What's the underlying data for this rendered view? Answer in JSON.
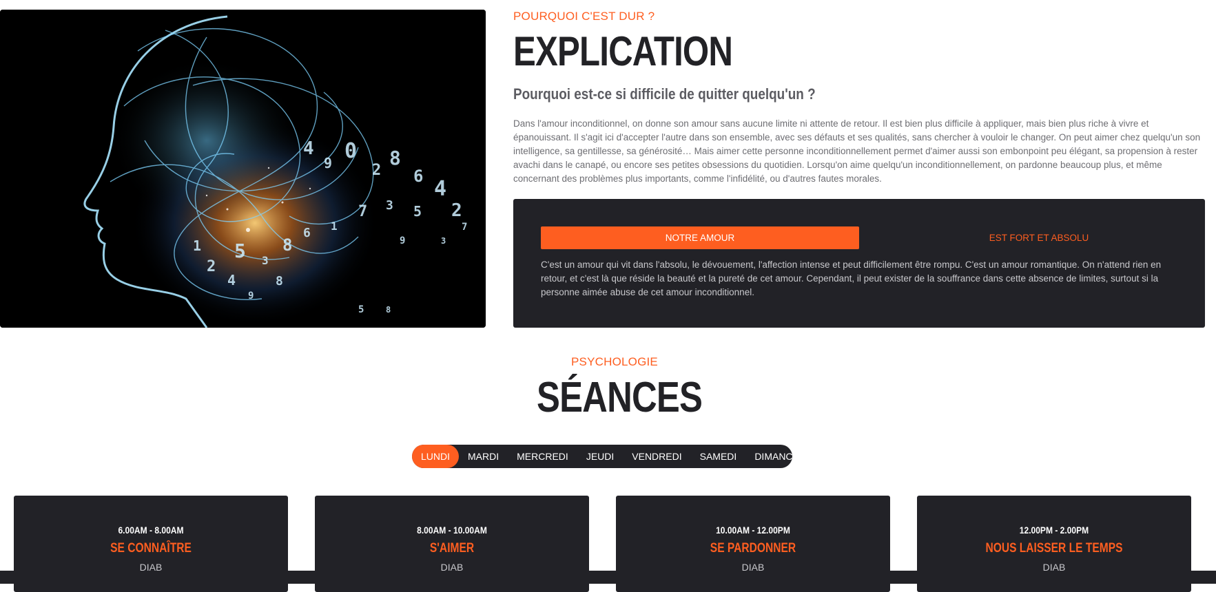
{
  "explication": {
    "kicker": "POURQUOI C'EST DUR ?",
    "title": "EXPLICATION",
    "subtitle": "Pourquoi est-ce si difficile de quitter quelqu'un ?",
    "paragraph": "Dans l'amour inconditionnel, on donne son amour sans aucune limite ni attente de retour. Il est bien plus difficile à appliquer, mais bien plus riche à vivre et épanouissant. Il s'agit ici d'accepter l'autre dans son ensemble, avec ses défauts et ses qualités, sans chercher à vouloir le changer. On peut aimer chez quelqu'un son intelligence, sa gentillesse, sa générosité… Mais aimer cette personne inconditionnellement permet d'aimer aussi son embonpoint peu élégant, sa propension à rester avachi dans le canapé, ou encore ses petites obsessions du quotidien. Lorsqu'on aime quelqu'un inconditionnellement, on pardonne beaucoup plus, et même concernant des problèmes plus importants, comme l'infidélité, ou d'autres fautes morales.",
    "tabs": {
      "active_label": "NOTRE AMOUR",
      "inactive_label": "EST FORT ET ABSOLU"
    },
    "tab_text": "C'est un amour qui vit dans l'absolu, le dévouement, l'affection intense et peut difficilement être rompu. C'est un amour romantique. On n'attend rien en retour, et c'est là que réside la beauté et la pureté de cet amour. Cependant, il peut exister de la souffrance dans cette absence de limites, surtout si la personne aimée abuse de cet amour inconditionnel."
  },
  "seances": {
    "kicker": "PSYCHOLOGIE",
    "title": "SÉANCES",
    "days": [
      "LUNDI",
      "MARDI",
      "MERCREDI",
      "JEUDI",
      "VENDREDI",
      "SAMEDI",
      "DIMANCHE"
    ],
    "active_day": "LUNDI",
    "cards": [
      {
        "time": "6.00AM - 8.00AM",
        "name": "SE CONNAÎTRE",
        "host": "DIAB"
      },
      {
        "time": "8.00AM - 10.00AM",
        "name": "S'AIMER",
        "host": "DIAB"
      },
      {
        "time": "10.00AM - 12.00PM",
        "name": "SE PARDONNER",
        "host": "DIAB"
      },
      {
        "time": "12.00PM - 2.00PM",
        "name": "NOUS LAISSER LE TEMPS",
        "host": "DIAB"
      }
    ]
  },
  "image": {
    "icon": "head-silhouette-with-numbers"
  },
  "colors": {
    "accent": "#fe5e20",
    "dark": "#222227"
  }
}
